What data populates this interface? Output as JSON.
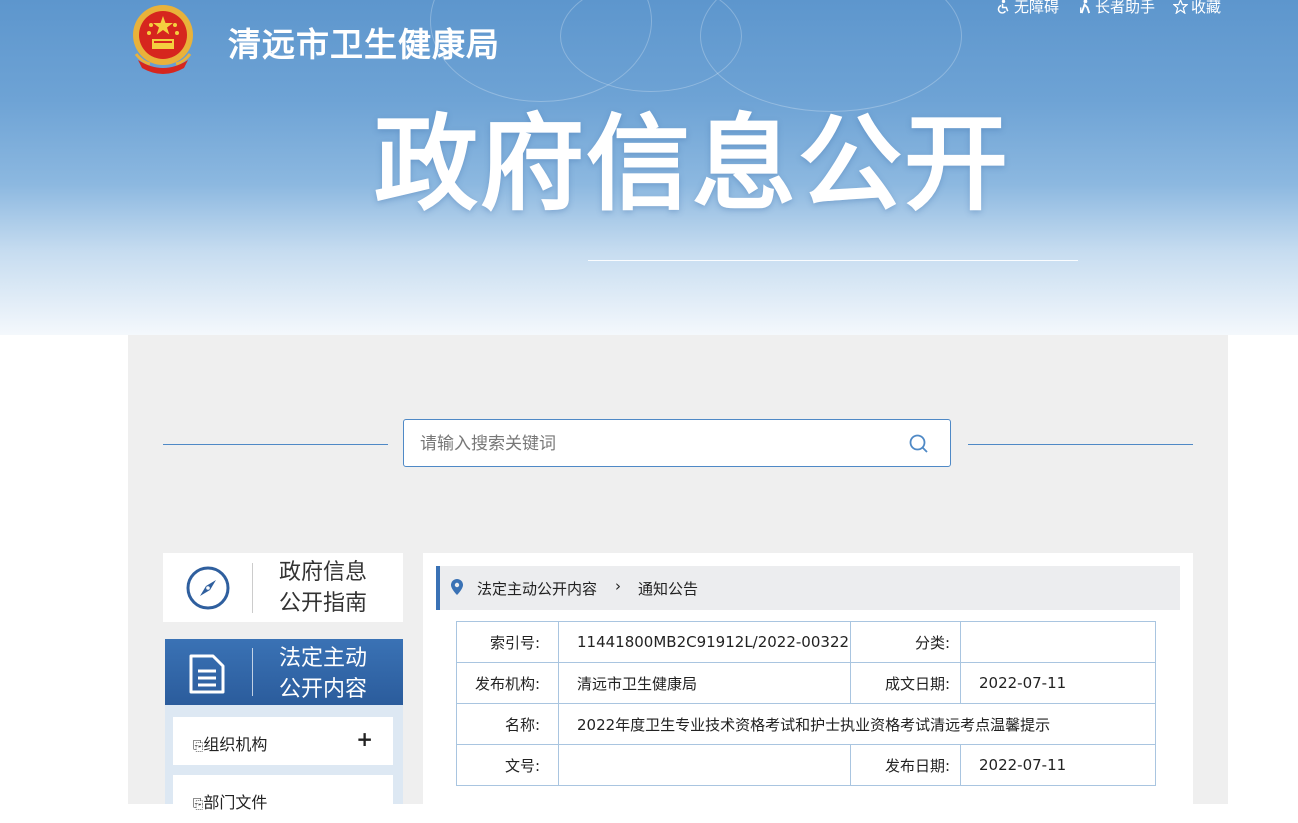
{
  "header": {
    "site_title": "清远市卫生健康局",
    "page_heading": "政府信息公开",
    "top_links": [
      {
        "icon": "wheelchair-icon",
        "label": "无障碍"
      },
      {
        "icon": "elder-icon",
        "label": "长者助手"
      },
      {
        "icon": "star-icon",
        "label": "收藏"
      }
    ]
  },
  "search": {
    "placeholder": "请输入搜索关键词"
  },
  "sidebar": {
    "guide": {
      "icon": "compass-icon",
      "line1": "政府信息",
      "line2": "公开指南"
    },
    "active": {
      "icon": "document-icon",
      "line1": "法定主动",
      "line2": "公开内容"
    },
    "items": [
      {
        "label": "组织机构",
        "expand": "+"
      },
      {
        "label": "部门文件"
      }
    ]
  },
  "breadcrumb": {
    "icon": "location-pin-icon",
    "level1": "法定主动公开内容",
    "separator": "›",
    "level2": "通知公告"
  },
  "meta": {
    "index_label": "索引号:",
    "index_value": "11441800MB2C91912L/2022-00322",
    "category_label": "分类:",
    "category_value": "",
    "publisher_label": "发布机构:",
    "publisher_value": "清远市卫生健康局",
    "created_label": "成文日期:",
    "created_value": "2022-07-11",
    "name_label": "名称:",
    "name_value": "2022年度卫生专业技术资格考试和护士执业资格考试清远考点温馨提示",
    "docno_label": "文号:",
    "docno_value": "",
    "published_label": "发布日期:",
    "published_value": "2022-07-11"
  },
  "colors": {
    "accent": "#3a72b5",
    "border": "#a9c5e0",
    "panel_bg": "#efefef"
  }
}
